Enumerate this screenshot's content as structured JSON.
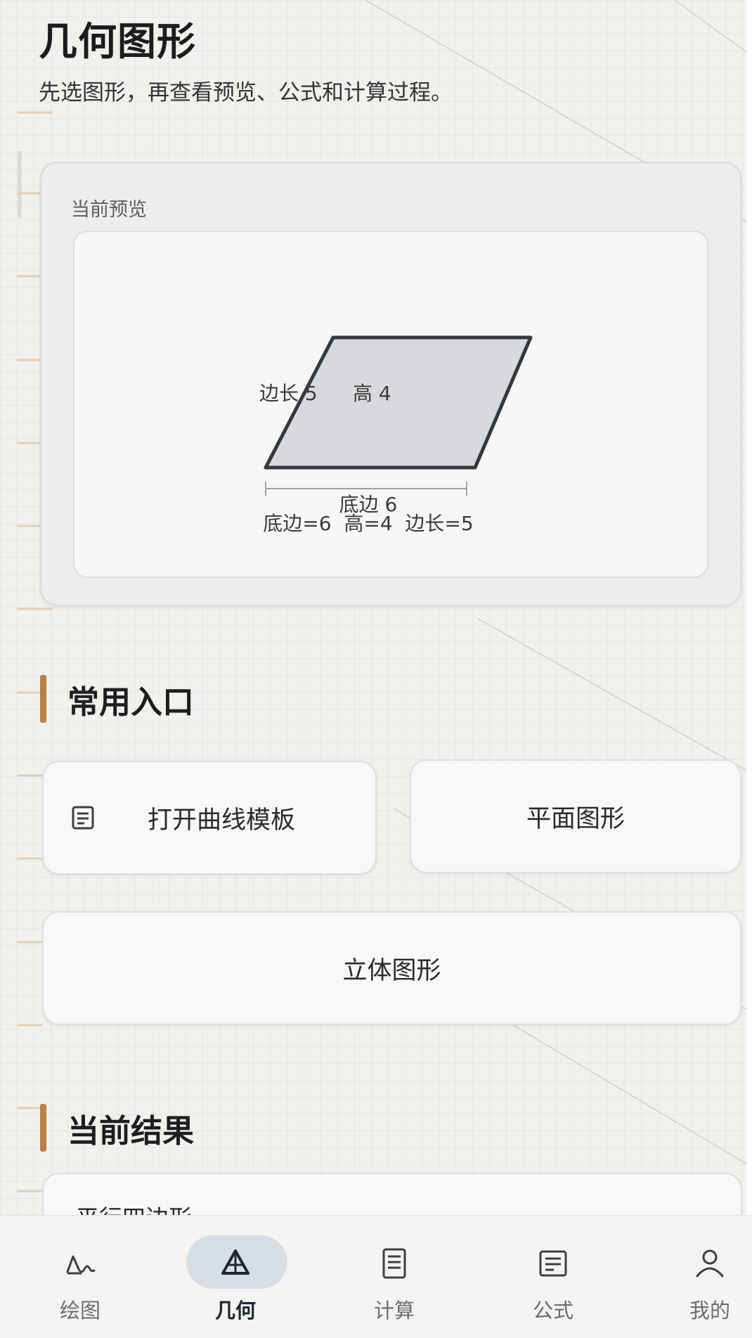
{
  "header": {
    "title": "几何图形",
    "subtitle": "先选图形，再查看预览、公式和计算过程。"
  },
  "preview": {
    "label": "当前预览",
    "side_label": "边长 5",
    "height_label": "高 4",
    "base_label": "底边 6",
    "summary": "底边=6  高=4  边长=5",
    "shape": "parallelogram",
    "base": 6,
    "height": 4,
    "side": 5,
    "colors": {
      "fill": "#d8d9dc",
      "stroke": "#34393e"
    }
  },
  "sections": {
    "common": "常用入口",
    "result": "当前结果"
  },
  "entries": {
    "curve_template": "打开曲线模板",
    "curve_icon": "document-icon",
    "plane": "平面图形",
    "solid": "立体图形"
  },
  "result": {
    "title": "平行四边形"
  },
  "nav": {
    "items": [
      {
        "label": "绘图",
        "icon": "curve-icon"
      },
      {
        "label": "几何",
        "icon": "triangle-icon",
        "active": true
      },
      {
        "label": "计算",
        "icon": "list-icon"
      },
      {
        "label": "公式",
        "icon": "formula-icon"
      },
      {
        "label": "我的",
        "icon": "user-icon"
      }
    ]
  },
  "colors": {
    "accent": "#b98049",
    "active_pill": "#d8dfe4",
    "background": "#f1f1ee"
  }
}
